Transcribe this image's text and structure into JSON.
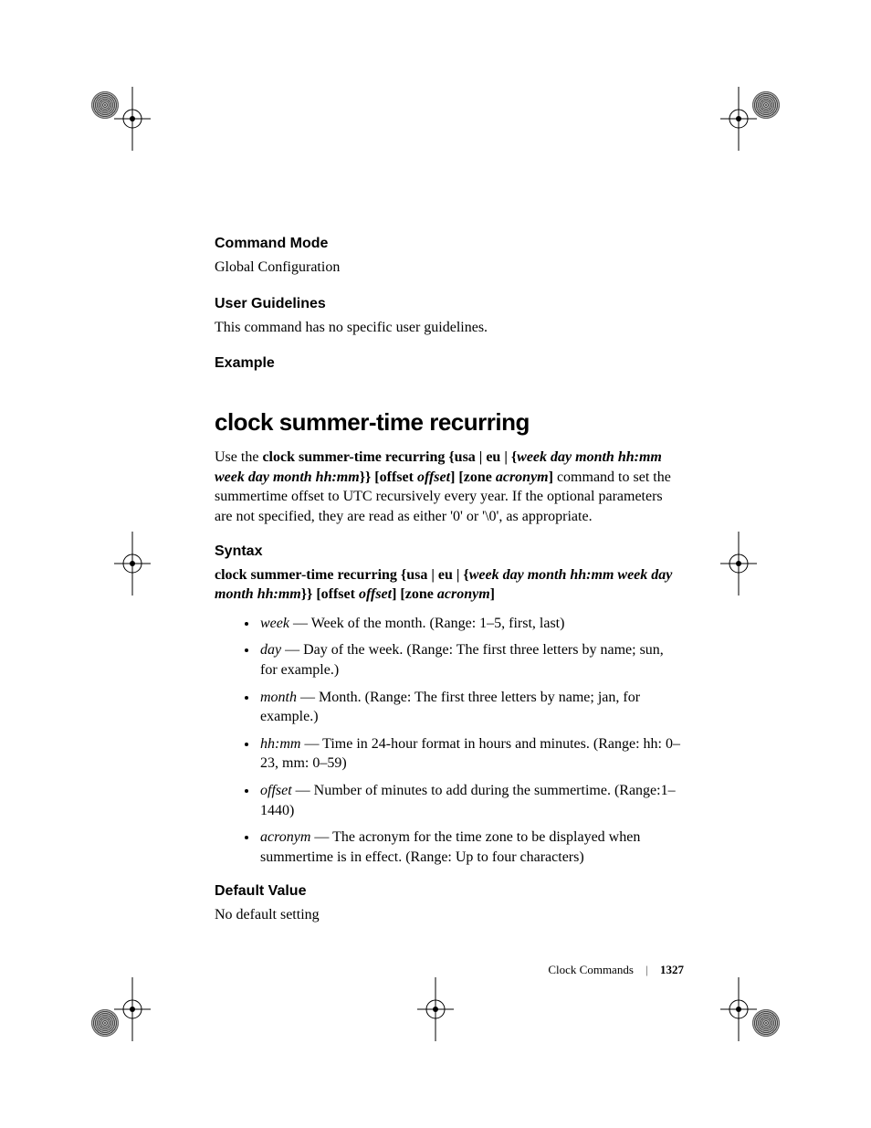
{
  "sections": {
    "command_mode": {
      "heading": "Command Mode",
      "body": "Global Configuration"
    },
    "user_guidelines": {
      "heading": "User Guidelines",
      "body": "This command has no specific user guidelines."
    },
    "example": {
      "heading": "Example"
    }
  },
  "command": {
    "title": "clock summer-time recurring",
    "intro": {
      "pre": "Use the ",
      "bold1": "clock summer-time recurring {usa | eu | {",
      "ital1": "week day month hh:mm week day month hh:mm",
      "bold2": "}} [offset ",
      "ital2": "offset",
      "bold3": "] [zone ",
      "ital3": "acronym",
      "bold4": "]",
      "post": " command to set the summertime offset to UTC recursively every year. If the optional parameters are not specified, they are read as either '0' or '\\0', as appropriate."
    },
    "syntax_heading": "Syntax",
    "syntax_line": {
      "bold1": "clock summer-time recurring {usa | eu | {",
      "ital1": "week day month hh:mm week day month hh:mm",
      "bold2": "}} [offset ",
      "ital2": "offset",
      "bold3": "] [zone ",
      "ital3": "acronym",
      "bold4": "]"
    },
    "params": [
      {
        "name": "week",
        "desc": " — Week of the month. (Range: 1–5, first, last)"
      },
      {
        "name": "day",
        "desc": " — Day of the week. (Range: The first three letters by name; sun, for example.)"
      },
      {
        "name": "month",
        "desc": " — Month. (Range: The first three letters by name; jan, for example.)"
      },
      {
        "name": "hh:mm",
        "desc": " — Time in 24-hour format in hours and minutes. (Range: hh: 0–23, mm: 0–59)"
      },
      {
        "name": "offset",
        "desc": " — Number of minutes to add during the summertime. (Range:1–1440)"
      },
      {
        "name": "acronym",
        "desc": " — The acronym for the time zone to be displayed when summertime is in effect. (Range: Up to four characters)"
      }
    ],
    "default_value": {
      "heading": "Default Value",
      "body": "No default setting"
    }
  },
  "footer": {
    "section": "Clock Commands",
    "page": "1327"
  }
}
